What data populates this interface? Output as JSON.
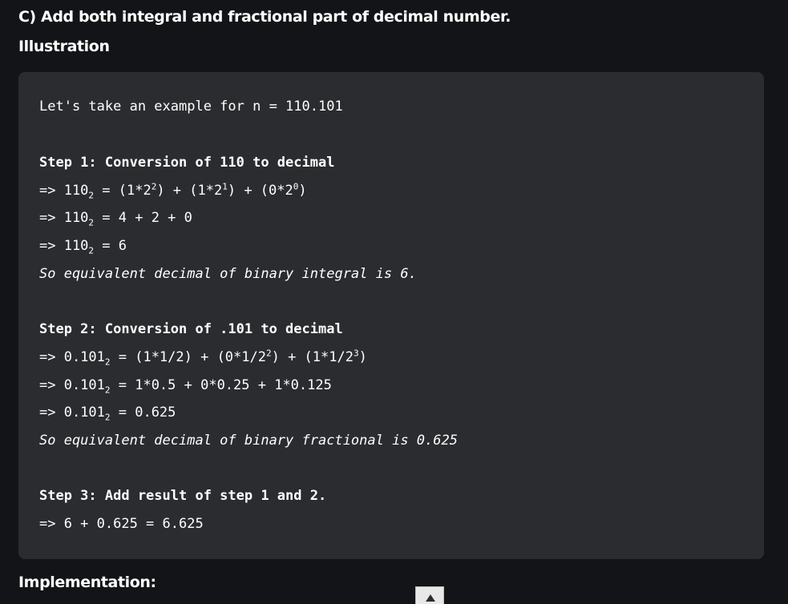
{
  "headings": {
    "subheading": "C) Add both integral and fractional part of decimal number.",
    "illustration": "Illustration",
    "implementation": "Implementation:"
  },
  "code": {
    "intro": "Let's take an example for n = 110.101",
    "step1": {
      "title": "Step 1: Conversion of 110 to decimal",
      "l1": {
        "prefix": "=> 110",
        "base": "2",
        "eq": " = (1*2",
        "e1": "2",
        "m1": ") + (1*2",
        "e2": "1",
        "m2": ") + (0*2",
        "e3": "0",
        "end": ")"
      },
      "l2": {
        "prefix": "=> 110",
        "base": "2",
        "rest": " = 4 + 2 + 0"
      },
      "l3": {
        "prefix": "=> 110",
        "base": "2",
        "rest": " = 6"
      },
      "conclusion": "So equivalent decimal of binary integral is 6."
    },
    "step2": {
      "title": "Step 2: Conversion of .101 to decimal",
      "l1": {
        "prefix": "=> 0.101",
        "base": "2",
        "eq": " = (1*1/2) + (0*1/2",
        "e1": "2",
        "m1": ") + (1*1/2",
        "e2": "3",
        "end": ")"
      },
      "l2": {
        "prefix": "=> 0.101",
        "base": "2",
        "rest": " = 1*0.5 + 0*0.25 + 1*0.125"
      },
      "l3": {
        "prefix": "=> 0.101",
        "base": "2",
        "rest": " = 0.625"
      },
      "conclusion": "So equivalent decimal of binary fractional is 0.625"
    },
    "step3": {
      "title": "Step 3: Add result of step 1 and 2.",
      "l1": "=> 6 + 0.625 = 6.625"
    }
  },
  "colors": {
    "background": "#131417",
    "codebox": "#2b2c2f",
    "text": "#ffffff"
  },
  "icons": {
    "scroll_top": "caret-up-icon"
  }
}
